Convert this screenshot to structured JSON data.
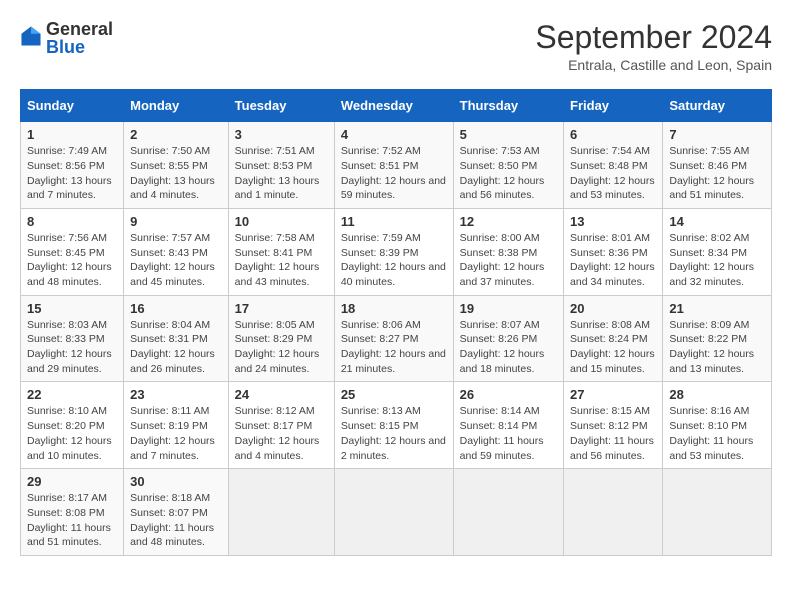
{
  "logo": {
    "general": "General",
    "blue": "Blue"
  },
  "title": "September 2024",
  "subtitle": "Entrala, Castille and Leon, Spain",
  "headers": [
    "Sunday",
    "Monday",
    "Tuesday",
    "Wednesday",
    "Thursday",
    "Friday",
    "Saturday"
  ],
  "weeks": [
    [
      {
        "day": "1",
        "sunrise": "Sunrise: 7:49 AM",
        "sunset": "Sunset: 8:56 PM",
        "daylight": "Daylight: 13 hours and 7 minutes."
      },
      {
        "day": "2",
        "sunrise": "Sunrise: 7:50 AM",
        "sunset": "Sunset: 8:55 PM",
        "daylight": "Daylight: 13 hours and 4 minutes."
      },
      {
        "day": "3",
        "sunrise": "Sunrise: 7:51 AM",
        "sunset": "Sunset: 8:53 PM",
        "daylight": "Daylight: 13 hours and 1 minute."
      },
      {
        "day": "4",
        "sunrise": "Sunrise: 7:52 AM",
        "sunset": "Sunset: 8:51 PM",
        "daylight": "Daylight: 12 hours and 59 minutes."
      },
      {
        "day": "5",
        "sunrise": "Sunrise: 7:53 AM",
        "sunset": "Sunset: 8:50 PM",
        "daylight": "Daylight: 12 hours and 56 minutes."
      },
      {
        "day": "6",
        "sunrise": "Sunrise: 7:54 AM",
        "sunset": "Sunset: 8:48 PM",
        "daylight": "Daylight: 12 hours and 53 minutes."
      },
      {
        "day": "7",
        "sunrise": "Sunrise: 7:55 AM",
        "sunset": "Sunset: 8:46 PM",
        "daylight": "Daylight: 12 hours and 51 minutes."
      }
    ],
    [
      {
        "day": "8",
        "sunrise": "Sunrise: 7:56 AM",
        "sunset": "Sunset: 8:45 PM",
        "daylight": "Daylight: 12 hours and 48 minutes."
      },
      {
        "day": "9",
        "sunrise": "Sunrise: 7:57 AM",
        "sunset": "Sunset: 8:43 PM",
        "daylight": "Daylight: 12 hours and 45 minutes."
      },
      {
        "day": "10",
        "sunrise": "Sunrise: 7:58 AM",
        "sunset": "Sunset: 8:41 PM",
        "daylight": "Daylight: 12 hours and 43 minutes."
      },
      {
        "day": "11",
        "sunrise": "Sunrise: 7:59 AM",
        "sunset": "Sunset: 8:39 PM",
        "daylight": "Daylight: 12 hours and 40 minutes."
      },
      {
        "day": "12",
        "sunrise": "Sunrise: 8:00 AM",
        "sunset": "Sunset: 8:38 PM",
        "daylight": "Daylight: 12 hours and 37 minutes."
      },
      {
        "day": "13",
        "sunrise": "Sunrise: 8:01 AM",
        "sunset": "Sunset: 8:36 PM",
        "daylight": "Daylight: 12 hours and 34 minutes."
      },
      {
        "day": "14",
        "sunrise": "Sunrise: 8:02 AM",
        "sunset": "Sunset: 8:34 PM",
        "daylight": "Daylight: 12 hours and 32 minutes."
      }
    ],
    [
      {
        "day": "15",
        "sunrise": "Sunrise: 8:03 AM",
        "sunset": "Sunset: 8:33 PM",
        "daylight": "Daylight: 12 hours and 29 minutes."
      },
      {
        "day": "16",
        "sunrise": "Sunrise: 8:04 AM",
        "sunset": "Sunset: 8:31 PM",
        "daylight": "Daylight: 12 hours and 26 minutes."
      },
      {
        "day": "17",
        "sunrise": "Sunrise: 8:05 AM",
        "sunset": "Sunset: 8:29 PM",
        "daylight": "Daylight: 12 hours and 24 minutes."
      },
      {
        "day": "18",
        "sunrise": "Sunrise: 8:06 AM",
        "sunset": "Sunset: 8:27 PM",
        "daylight": "Daylight: 12 hours and 21 minutes."
      },
      {
        "day": "19",
        "sunrise": "Sunrise: 8:07 AM",
        "sunset": "Sunset: 8:26 PM",
        "daylight": "Daylight: 12 hours and 18 minutes."
      },
      {
        "day": "20",
        "sunrise": "Sunrise: 8:08 AM",
        "sunset": "Sunset: 8:24 PM",
        "daylight": "Daylight: 12 hours and 15 minutes."
      },
      {
        "day": "21",
        "sunrise": "Sunrise: 8:09 AM",
        "sunset": "Sunset: 8:22 PM",
        "daylight": "Daylight: 12 hours and 13 minutes."
      }
    ],
    [
      {
        "day": "22",
        "sunrise": "Sunrise: 8:10 AM",
        "sunset": "Sunset: 8:20 PM",
        "daylight": "Daylight: 12 hours and 10 minutes."
      },
      {
        "day": "23",
        "sunrise": "Sunrise: 8:11 AM",
        "sunset": "Sunset: 8:19 PM",
        "daylight": "Daylight: 12 hours and 7 minutes."
      },
      {
        "day": "24",
        "sunrise": "Sunrise: 8:12 AM",
        "sunset": "Sunset: 8:17 PM",
        "daylight": "Daylight: 12 hours and 4 minutes."
      },
      {
        "day": "25",
        "sunrise": "Sunrise: 8:13 AM",
        "sunset": "Sunset: 8:15 PM",
        "daylight": "Daylight: 12 hours and 2 minutes."
      },
      {
        "day": "26",
        "sunrise": "Sunrise: 8:14 AM",
        "sunset": "Sunset: 8:14 PM",
        "daylight": "Daylight: 11 hours and 59 minutes."
      },
      {
        "day": "27",
        "sunrise": "Sunrise: 8:15 AM",
        "sunset": "Sunset: 8:12 PM",
        "daylight": "Daylight: 11 hours and 56 minutes."
      },
      {
        "day": "28",
        "sunrise": "Sunrise: 8:16 AM",
        "sunset": "Sunset: 8:10 PM",
        "daylight": "Daylight: 11 hours and 53 minutes."
      }
    ],
    [
      {
        "day": "29",
        "sunrise": "Sunrise: 8:17 AM",
        "sunset": "Sunset: 8:08 PM",
        "daylight": "Daylight: 11 hours and 51 minutes."
      },
      {
        "day": "30",
        "sunrise": "Sunrise: 8:18 AM",
        "sunset": "Sunset: 8:07 PM",
        "daylight": "Daylight: 11 hours and 48 minutes."
      },
      null,
      null,
      null,
      null,
      null
    ]
  ]
}
